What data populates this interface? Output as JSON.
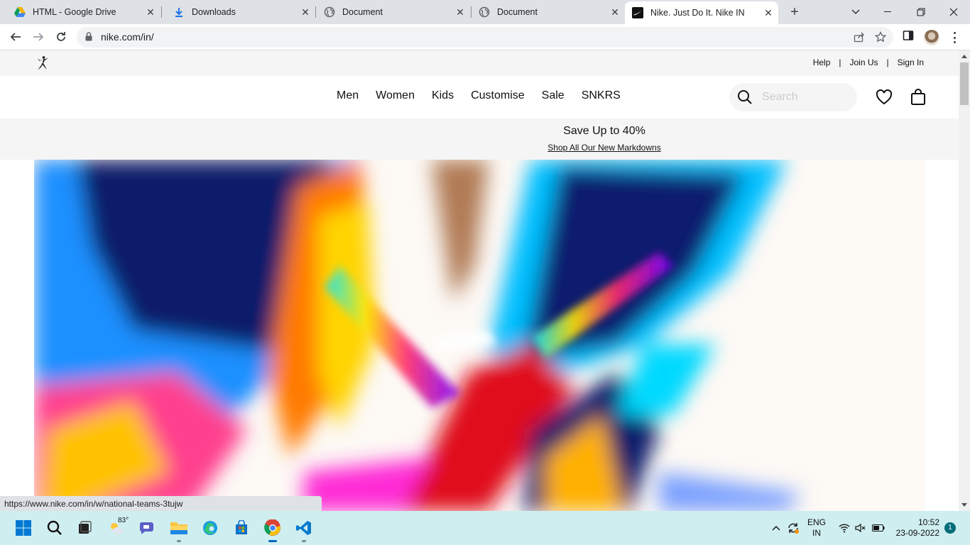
{
  "browser": {
    "tabs": [
      {
        "title": "HTML - Google Drive",
        "icon": "google-drive-icon",
        "active": false
      },
      {
        "title": "Downloads",
        "icon": "download-icon",
        "active": false
      },
      {
        "title": "Document",
        "icon": "globe-icon",
        "active": false
      },
      {
        "title": "Document",
        "icon": "globe-icon",
        "active": false
      },
      {
        "title": "Nike. Just Do It. Nike IN",
        "icon": "nike-swoosh-icon",
        "active": true
      }
    ],
    "url": "nike.com/in/"
  },
  "nike": {
    "utility_links": {
      "help": "Help",
      "join": "Join Us",
      "sign_in": "Sign In",
      "separator": "|"
    },
    "nav": [
      "Men",
      "Women",
      "Kids",
      "Customise",
      "Sale",
      "SNKRS"
    ],
    "search_placeholder": "Search",
    "promo": {
      "headline": "Save Up to 40%",
      "link": "Shop All Our New Markdowns"
    }
  },
  "status_bar": {
    "url": "https://www.nike.com/in/w/national-teams-3tujw"
  },
  "taskbar": {
    "weather_temp": "83°",
    "language": {
      "line1": "ENG",
      "line2": "IN"
    },
    "clock": {
      "time": "10:52",
      "date": "23-09-2022"
    },
    "notification_count": "1"
  },
  "colors": {
    "accent_chrome_blue": "#1a73e8",
    "taskbar": "#cfeef0",
    "nike_grey": "#f5f5f5"
  }
}
